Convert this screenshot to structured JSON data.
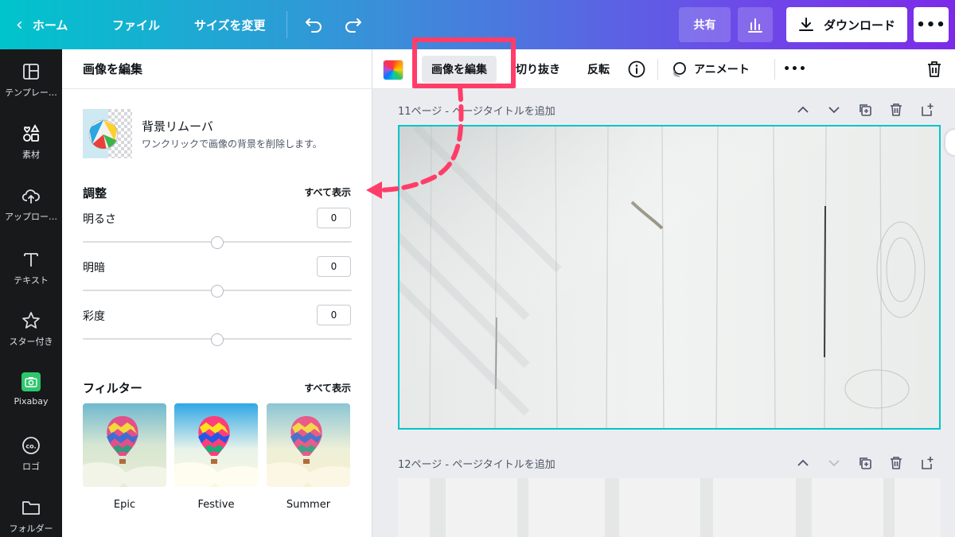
{
  "topbar": {
    "home_label": "ホーム",
    "file_label": "ファイル",
    "resize_label": "サイズを変更",
    "share_label": "共有",
    "download_label": "ダウンロード",
    "more_label": "•••",
    "gradient_start": "#00c4cc",
    "gradient_end": "#7d2ae8"
  },
  "sidebar": {
    "items": [
      {
        "label": "テンプレー…",
        "icon": "layout-icon"
      },
      {
        "label": "素材",
        "icon": "shapes-icon"
      },
      {
        "label": "アップロー…",
        "icon": "cloud-upload-icon"
      },
      {
        "label": "テキスト",
        "icon": "text-icon"
      },
      {
        "label": "スター付き",
        "icon": "star-icon"
      },
      {
        "label": "Pixabay",
        "icon": "camera-icon"
      },
      {
        "label": "ロゴ",
        "icon": "logo-icon"
      },
      {
        "label": "フォルダー",
        "icon": "folder-icon"
      }
    ],
    "active_index": 1
  },
  "panel": {
    "title": "画像を編集",
    "bg_remover": {
      "title": "背景リムーバ",
      "description": "ワンクリックで画像の背景を削除します。"
    },
    "adjust": {
      "title": "調整",
      "see_all": "すべて表示",
      "items": [
        {
          "label": "明るさ",
          "value": "0",
          "position": 0.5
        },
        {
          "label": "明暗",
          "value": "0",
          "position": 0.5
        },
        {
          "label": "彩度",
          "value": "0",
          "position": 0.5
        }
      ]
    },
    "filters": {
      "title": "フィルター",
      "see_all": "すべて表示",
      "items": [
        {
          "name": "Epic"
        },
        {
          "name": "Festive"
        },
        {
          "name": "Summer"
        }
      ]
    }
  },
  "context_toolbar": {
    "edit_image": "画像を編集",
    "crop": "切り抜き",
    "flip": "反転",
    "animate": "アニメート"
  },
  "canvas": {
    "page11_label": "11ページ - ページタイトルを追加",
    "page12_label": "12ページ - ページタイトルを追加",
    "selection_color": "#00c4cc"
  },
  "annotation": {
    "highlight_color": "#ff3d69"
  }
}
